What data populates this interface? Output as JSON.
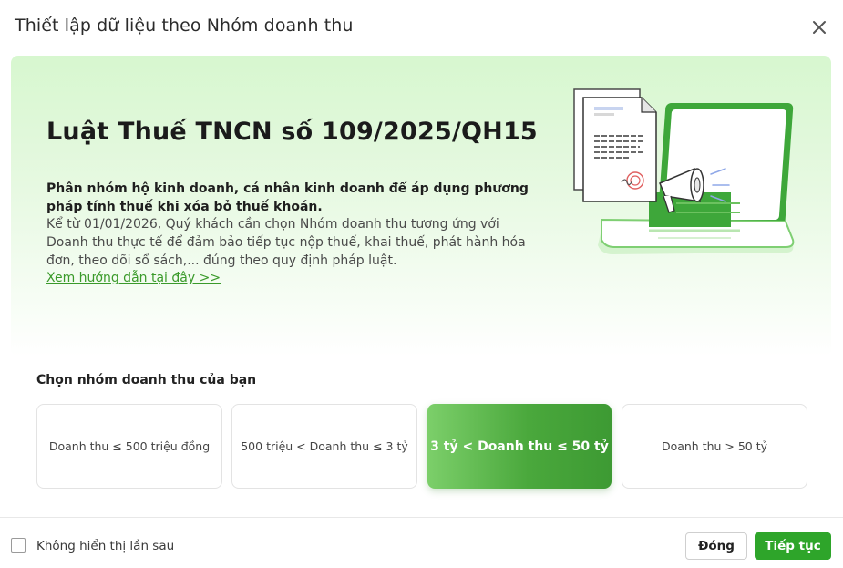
{
  "dialog": {
    "title": "Thiết lập dữ liệu theo Nhóm doanh thu",
    "close_icon": "close-icon"
  },
  "banner": {
    "law_title": "Luật Thuế TNCN số 109/2025/QH15",
    "desc_bold": "Phân nhóm hộ kinh doanh, cá nhân kinh doanh để áp dụng phương pháp tính thuế khi xóa bỏ thuế khoán.",
    "desc_text": "Kể từ 01/01/2026, Quý khách cần chọn Nhóm doanh thu tương ứng với Doanh thu thực tế để đảm bảo tiếp tục nộp thuế, khai thuế, phát hành hóa đơn, theo dõi sổ sách,... đúng theo quy định pháp luật.",
    "guide_link": "Xem hướng dẫn tại đây >>",
    "illustration_icon": "laptop-document-megaphone-illustration"
  },
  "revenue_groups": {
    "label": "Chọn nhóm doanh thu của bạn",
    "options": [
      {
        "label": "Doanh thu ≤ 500 triệu đồng",
        "selected": false
      },
      {
        "label": "500 triệu < Doanh thu ≤ 3 tỷ",
        "selected": false
      },
      {
        "label": "3 tỷ < Doanh thu ≤ 50 tỷ",
        "selected": true
      },
      {
        "label": "Doanh thu > 50 tỷ",
        "selected": false
      }
    ]
  },
  "footer": {
    "dont_show_label": "Không hiển thị lần sau",
    "dont_show_checked": false,
    "close_label": "Đóng",
    "next_label": "Tiếp tục"
  },
  "colors": {
    "accent": "#2ea52a",
    "link": "#3a9a2a",
    "banner_bg": "#d7f7cf"
  }
}
